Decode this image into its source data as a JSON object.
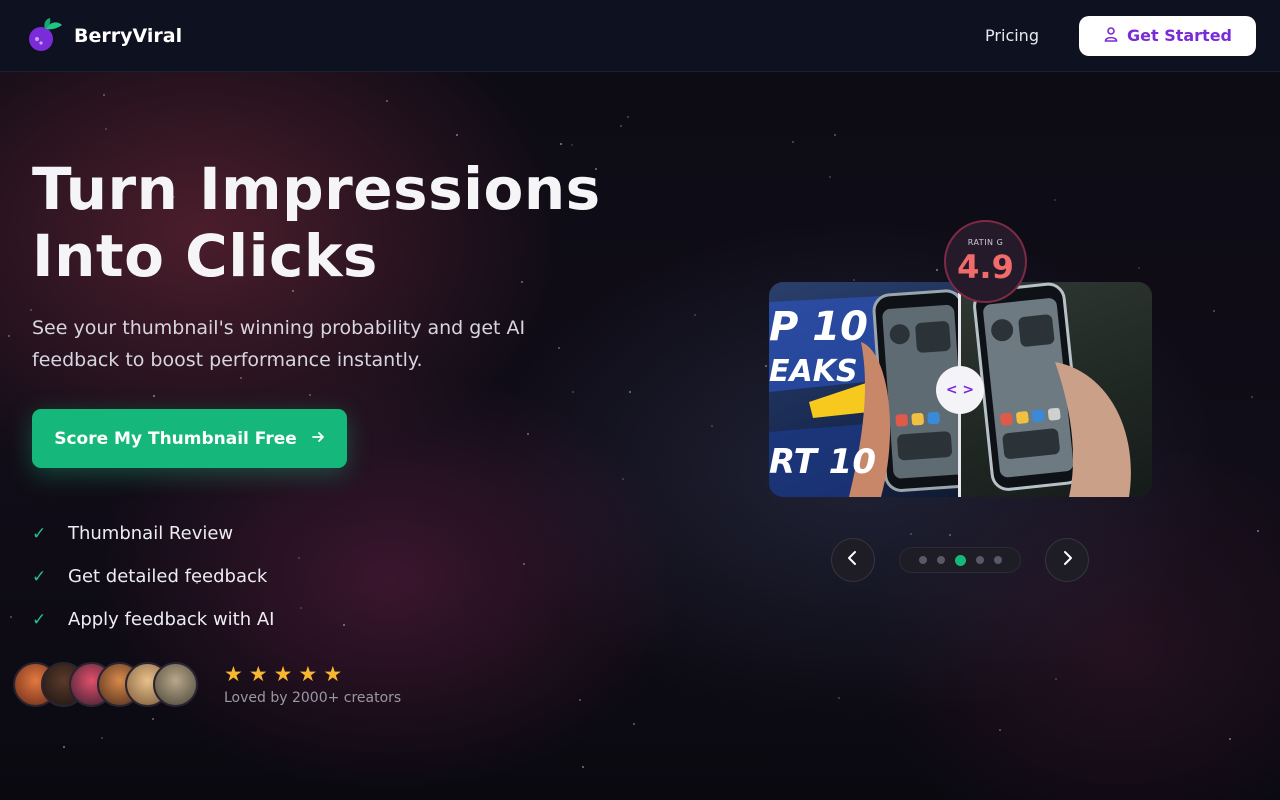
{
  "brand": {
    "name": "BerryViral",
    "logo": "berry-logo-icon"
  },
  "nav": {
    "pricing_label": "Pricing",
    "cta_label": "Get Started",
    "cta_icon": "user-icon"
  },
  "hero": {
    "title_line1": "Turn Impressions",
    "title_line2": "Into Clicks",
    "subtitle": "See your thumbnail's winning probability and get AI feedback to boost performance instantly.",
    "cta_label": "Score My Thumbnail Free",
    "cta_icon": "arrow-right-icon"
  },
  "features": [
    {
      "label": "Thumbnail Review",
      "icon": "check-icon"
    },
    {
      "label": "Get detailed feedback",
      "icon": "check-icon"
    },
    {
      "label": "Apply feedback with AI",
      "icon": "check-icon"
    }
  ],
  "social_proof": {
    "stars": 5,
    "text": "Loved by 2000+ creators"
  },
  "compare": {
    "rating_label": "RATIN G",
    "rating_value": "4.9",
    "handle_label": "< >",
    "left_text_1": "P 10",
    "left_text_2": "EAKS",
    "left_text_3": "RT 10",
    "active_slide": 3,
    "total_slides": 5
  },
  "colors": {
    "accent_green": "#15b87a",
    "accent_purple": "#7a2bd8",
    "rating_red": "#f26b6b",
    "star_gold": "#f7b731"
  }
}
